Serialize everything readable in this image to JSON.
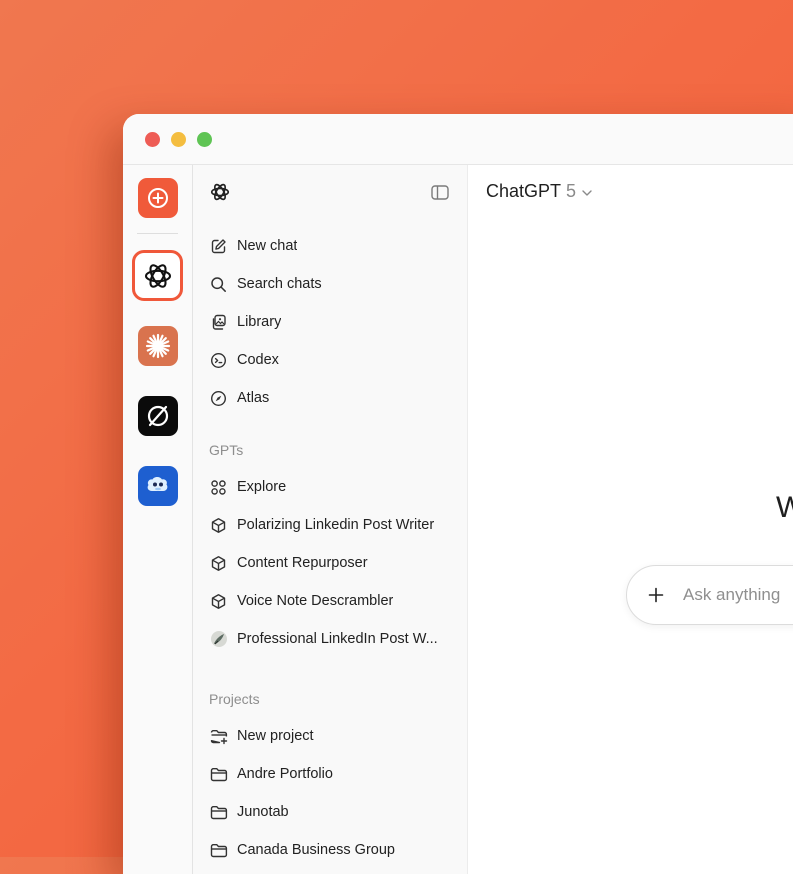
{
  "main": {
    "model_name": "ChatGPT",
    "model_version": "5",
    "greeting": "W",
    "composer_placeholder": "Ask anything"
  },
  "sidebar": {
    "nav": [
      {
        "label": "New chat",
        "icon": "compose-icon"
      },
      {
        "label": "Search chats",
        "icon": "search-icon"
      },
      {
        "label": "Library",
        "icon": "library-icon"
      },
      {
        "label": "Codex",
        "icon": "codex-icon"
      },
      {
        "label": "Atlas",
        "icon": "compass-icon"
      }
    ],
    "gpts_label": "GPTs",
    "gpts": [
      {
        "label": "Explore",
        "icon": "grid-icon"
      },
      {
        "label": "Polarizing Linkedin Post Writer",
        "icon": "cube-icon"
      },
      {
        "label": "Content Repurposer",
        "icon": "cube-icon"
      },
      {
        "label": "Voice Note Descrambler",
        "icon": "cube-icon"
      },
      {
        "label": "Professional LinkedIn Post W...",
        "icon": "gpt-avatar-icon"
      }
    ],
    "projects_label": "Projects",
    "projects": [
      {
        "label": "New project",
        "icon": "folder-plus-icon"
      },
      {
        "label": "Andre Portfolio",
        "icon": "folder-icon"
      },
      {
        "label": "Junotab",
        "icon": "folder-icon"
      },
      {
        "label": "Canada Business Group",
        "icon": "folder-icon"
      }
    ]
  },
  "rail": {
    "apps": [
      "add-app-icon",
      "chatgpt-app-icon",
      "claude-app-icon",
      "perplexity-app-icon",
      "mascot-app-icon"
    ]
  },
  "colors": {
    "background": "#f36a44",
    "accent": "#f0583a",
    "claude": "#d9734e"
  }
}
